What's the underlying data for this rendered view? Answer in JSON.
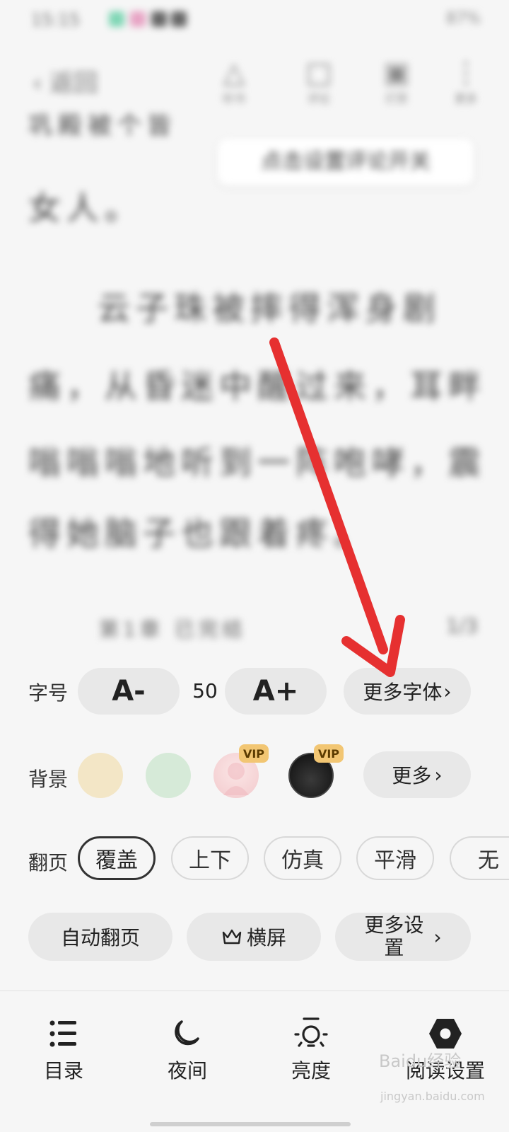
{
  "reader": {
    "status_time": "15:15",
    "status_right": "87%",
    "back_label": "返回",
    "tools": [
      {
        "icon": "listen-icon",
        "label": "听书"
      },
      {
        "icon": "comment-icon",
        "label": "评论"
      },
      {
        "icon": "gift-icon",
        "label": "打赏"
      },
      {
        "icon": "more-icon",
        "label": "更多"
      }
    ],
    "paragraph_lines": [
      "巩殿被个皆",
      "女人。",
      "云子珠被摔得浑身剧",
      "痛，从昏迷中醒过来，耳畔",
      "嗡嗡嗡地听到一阵咆哮，震",
      "得她脑子也跟着疼。"
    ],
    "bubble_text": "点击设置评论开关",
    "footer_line": "第1章 已完结",
    "footer_right": "1/3"
  },
  "panel": {
    "font_size": {
      "label": "字号",
      "decrease": "A-",
      "value": "50",
      "increase": "A+",
      "more_fonts": "更多字体"
    },
    "background": {
      "label": "背景",
      "swatches": [
        {
          "name": "cream",
          "color": "#f3e6c6",
          "vip": false
        },
        {
          "name": "mint",
          "color": "#d6ead8",
          "vip": false
        },
        {
          "name": "pink-image",
          "color": "#f7d9d9",
          "vip": true
        },
        {
          "name": "dark-image",
          "color": "#1a1a1a",
          "vip": true
        }
      ],
      "vip_badge": "VIP",
      "more": "更多"
    },
    "page_turn": {
      "label": "翻页",
      "options": [
        "覆盖",
        "上下",
        "仿真",
        "平滑",
        "无"
      ],
      "selected": "覆盖"
    },
    "actions": {
      "auto_turn": "自动翻页",
      "landscape": "横屏",
      "more_settings_line1": "更多设",
      "more_settings_line2": "置"
    },
    "bottom_nav": {
      "toc": "目录",
      "night": "夜间",
      "brightness": "亮度",
      "reading_settings": "阅读设置"
    },
    "watermark": "Baidu经验",
    "watermark_sub": "jingyan.baidu.com"
  }
}
